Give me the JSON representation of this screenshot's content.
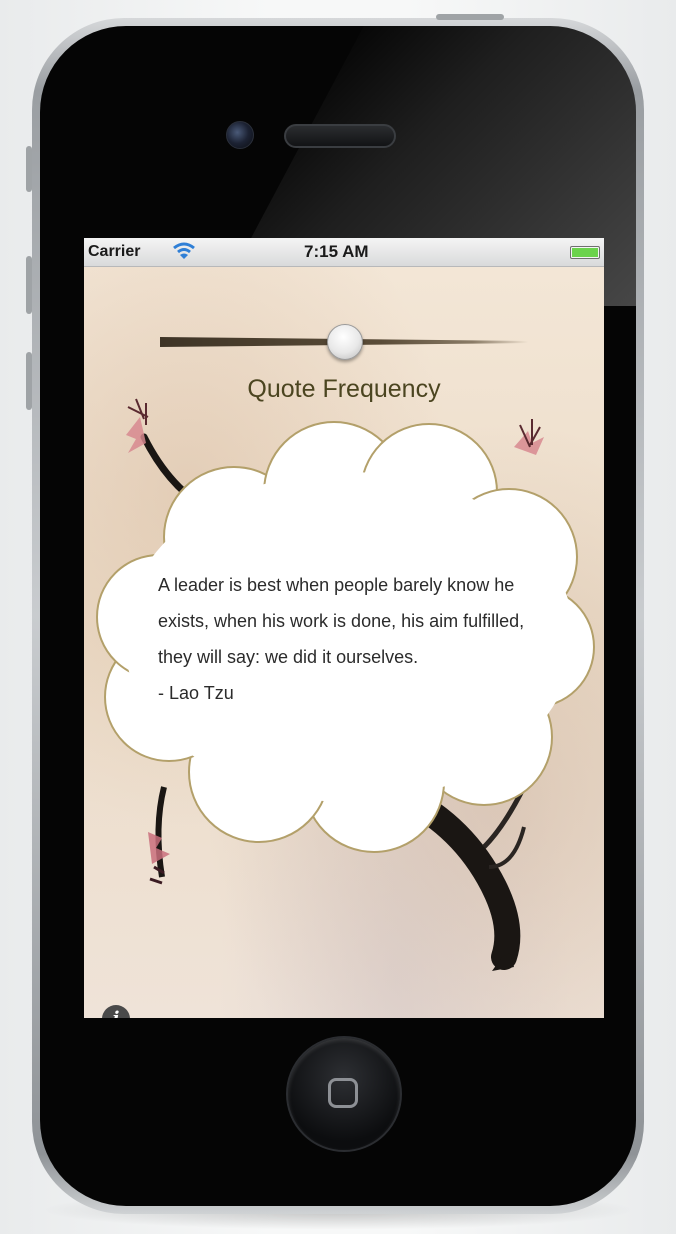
{
  "status_bar": {
    "carrier": "Carrier",
    "time": "7:15 AM",
    "wifi_icon": "wifi-icon",
    "battery_icon": "battery-icon",
    "battery_color": "#6bd34c"
  },
  "frequency": {
    "label": "Quote Frequency",
    "slider_value": 0.5
  },
  "quote": {
    "text": "A leader is best when people barely know he exists, when his work is done, his aim fulfilled, they will say: we did it ourselves.",
    "author": " - Lao Tzu"
  },
  "info_button": {
    "icon": "info-icon",
    "glyph": "i"
  },
  "home_button": {
    "icon": "home-square-icon"
  },
  "colors": {
    "paper": "#efe3d2",
    "cloud_fill": "#ffffff",
    "cloud_stroke": "#b3a06a",
    "label_text": "#4b4520"
  }
}
